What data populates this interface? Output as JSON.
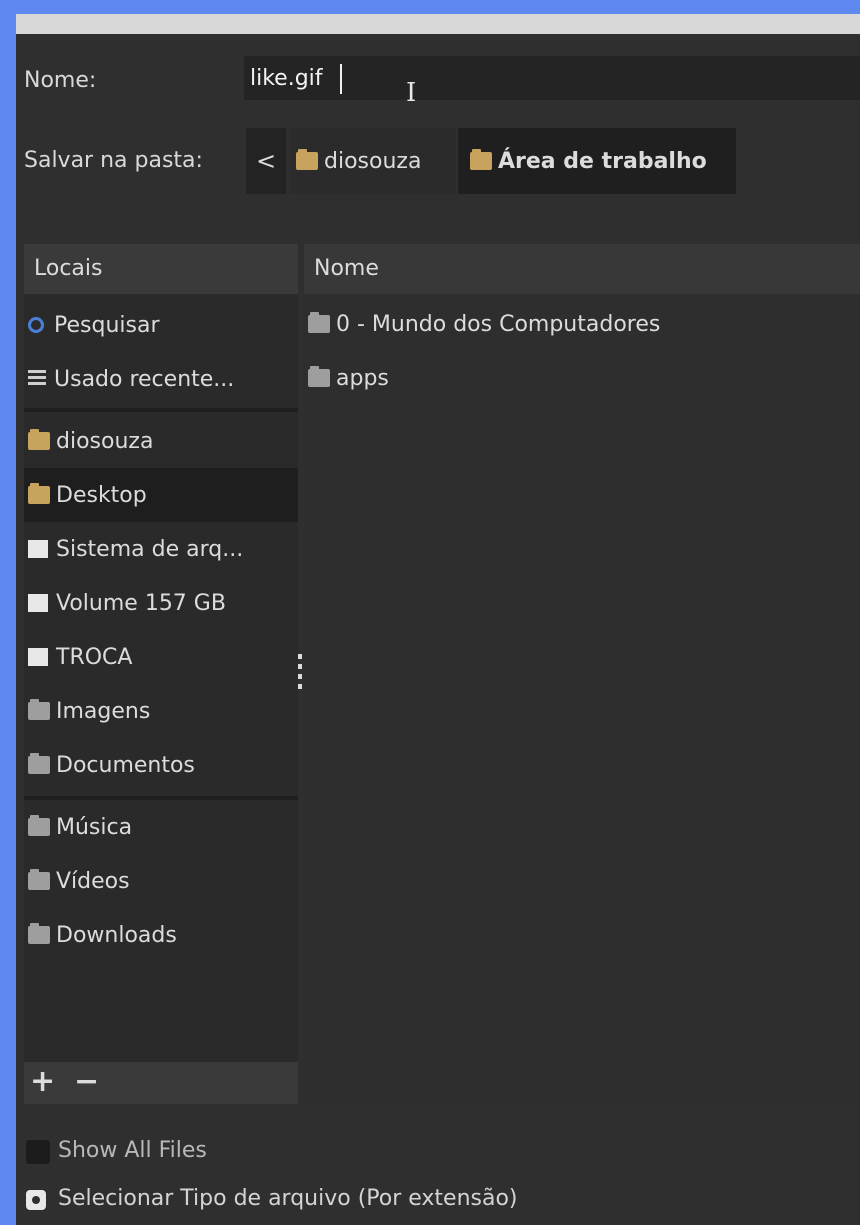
{
  "dialog": {
    "name_label": "Nome:",
    "name_value": "like.gif",
    "save_in_label": "Salvar na pasta:",
    "breadcrumb": {
      "back": "<",
      "items": [
        "diosouza",
        "Área de trabalho"
      ]
    }
  },
  "places": {
    "header": "Locais",
    "items": [
      {
        "label": "Pesquisar",
        "icon": "search-icon"
      },
      {
        "label": "Usado recente...",
        "icon": "recent-icon"
      },
      {
        "label": "diosouza",
        "icon": "home-folder-icon"
      },
      {
        "label": "Desktop",
        "icon": "desktop-folder-icon",
        "selected": true
      },
      {
        "label": "Sistema de arq...",
        "icon": "drive-icon"
      },
      {
        "label": "Volume 157 GB",
        "icon": "drive-icon"
      },
      {
        "label": "TROCA",
        "icon": "drive-icon"
      },
      {
        "label": "Imagens",
        "icon": "folder-icon"
      },
      {
        "label": "Documentos",
        "icon": "folder-icon"
      },
      {
        "label": "Música",
        "icon": "folder-icon"
      },
      {
        "label": "Vídeos",
        "icon": "folder-icon"
      },
      {
        "label": "Downloads",
        "icon": "folder-icon"
      }
    ],
    "add": "+",
    "remove": "−"
  },
  "files": {
    "column_name": "Nome",
    "rows": [
      "0 - Mundo dos Computadores",
      "apps"
    ]
  },
  "options": {
    "show_all_files": "Show All Files",
    "select_file_type": "Selecionar Tipo de arquivo (Por extensão)"
  }
}
